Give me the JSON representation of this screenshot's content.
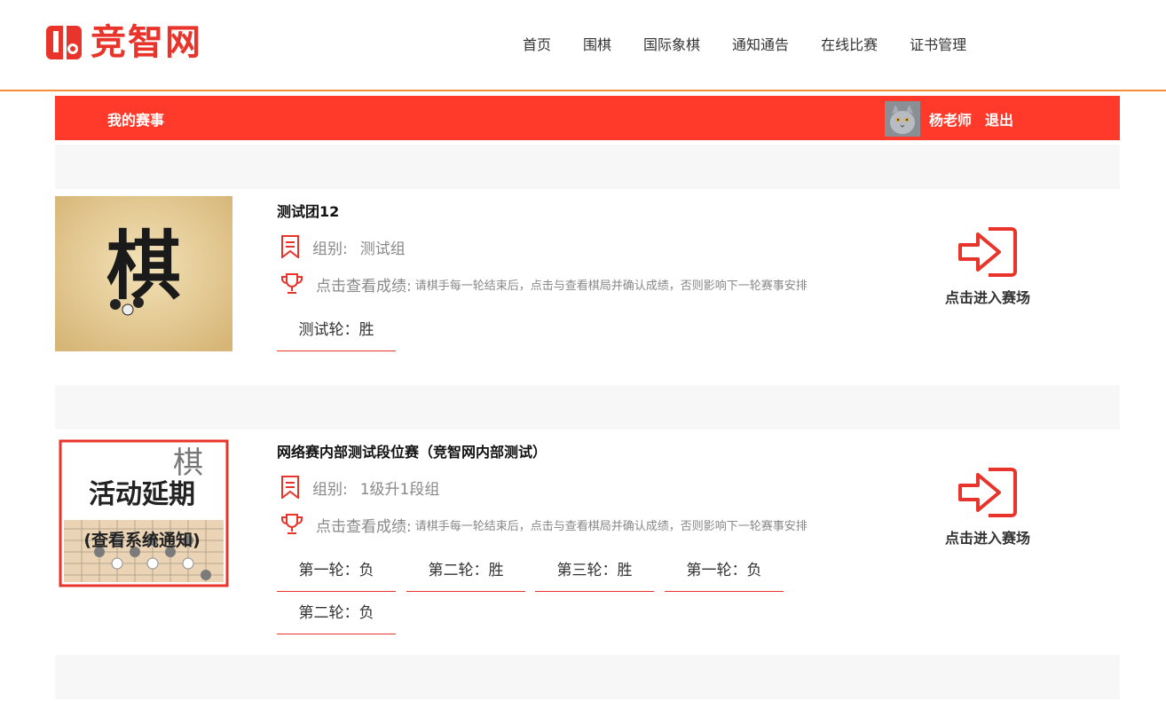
{
  "header": {
    "logo_text": "竞智网",
    "nav": [
      "首页",
      "围棋",
      "国际象棋",
      "通知通告",
      "在线比赛",
      "证书管理"
    ]
  },
  "subbar": {
    "my_events": "我的赛事",
    "username": "杨老师",
    "logout": "退出"
  },
  "events": [
    {
      "image_char": "棋",
      "name": "测试团12",
      "group_label": "组别:",
      "group_value": "测试组",
      "score_label": "点击查看成绩:",
      "score_note": "请棋手每一轮结束后，点击与查看棋局并确认成绩，否则影响下一轮赛事安排",
      "rounds": [
        "测试轮：胜"
      ],
      "enter_label": "点击进入赛场"
    },
    {
      "image_line1": "活动延期",
      "image_line2": "(查看系统通知)",
      "image_char": "棋",
      "name": "网络赛内部测试段位赛（竞智网内部测试）",
      "group_label": "组别:",
      "group_value": "1级升1段组",
      "score_label": "点击查看成绩:",
      "score_note": "请棋手每一轮结束后，点击与查看棋局并确认成绩，否则影响下一轮赛事安排",
      "rounds": [
        "第一轮：负",
        "第二轮：胜",
        "第三轮：胜",
        "第一轮：负",
        "第二轮：负"
      ],
      "enter_label": "点击进入赛场"
    }
  ],
  "colors": {
    "brand_red": "#e8342a",
    "bar_red": "#ff3a2b",
    "header_line": "#f0913a",
    "gap_gray": "#f7f7f7"
  }
}
